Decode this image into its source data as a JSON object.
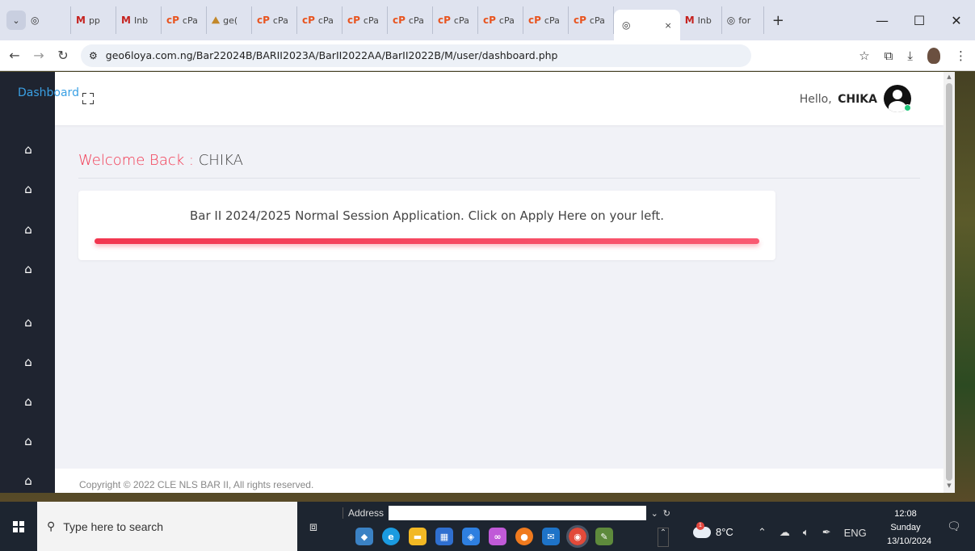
{
  "browser": {
    "tab_dropdown_icon": "chevron-down-icon",
    "tabs": [
      {
        "icon": "globe-icon",
        "label": ""
      },
      {
        "icon": "gmail-icon",
        "label": "pp"
      },
      {
        "icon": "gmail-icon",
        "label": "Inb"
      },
      {
        "icon": "cpanel-icon",
        "label": "cPa"
      },
      {
        "icon": "ng-icon",
        "label": "ge("
      },
      {
        "icon": "cpanel-icon",
        "label": "cPa"
      },
      {
        "icon": "cpanel-icon",
        "label": "cPa"
      },
      {
        "icon": "cpanel-icon",
        "label": "cPa"
      },
      {
        "icon": "cpanel-icon",
        "label": "cPa"
      },
      {
        "icon": "cpanel-icon",
        "label": "cPa"
      },
      {
        "icon": "cpanel-icon",
        "label": "cPa"
      },
      {
        "icon": "cpanel-icon",
        "label": "cPa"
      },
      {
        "icon": "cpanel-icon",
        "label": "cPa"
      }
    ],
    "active_tab": {
      "icon": "globe-icon",
      "close": "×"
    },
    "tabs_after": [
      {
        "icon": "gmail-icon",
        "label": "Inb"
      },
      {
        "icon": "globe-icon",
        "label": "for"
      }
    ],
    "new_tab": "+",
    "window_controls": {
      "minimize": "—",
      "maximize": "☐",
      "close": "✕"
    },
    "url": "geo6loya.com.ng/Bar22024B/BARII2023A/BarII2022AA/BarII2022B/M/user/dashboard.php"
  },
  "page": {
    "brand": "Dashboard",
    "greeting_prefix": "Hello,",
    "user_name": "CHIKA",
    "welcome_label": "Welcome Back :",
    "welcome_name": "CHIKA",
    "notice": "Bar II 2024/2025 Normal Session Application. Click on Apply Here on your left.",
    "progress_percent": 100,
    "footer": "Copyright © 2022 CLE NLS BAR II, All rights reserved.",
    "sidebar_icon_count": 9,
    "colors": {
      "accent": "#f2364f",
      "sidebar": "#1f2430",
      "brand": "#3aa0e4"
    }
  },
  "taskbar": {
    "search_placeholder": "Type here to search",
    "address_label": "Address",
    "weather": "8°C",
    "weather_badge": "1",
    "language": "ENG",
    "time": "12:08",
    "day": "Sunday",
    "date": "13/10/2024"
  }
}
